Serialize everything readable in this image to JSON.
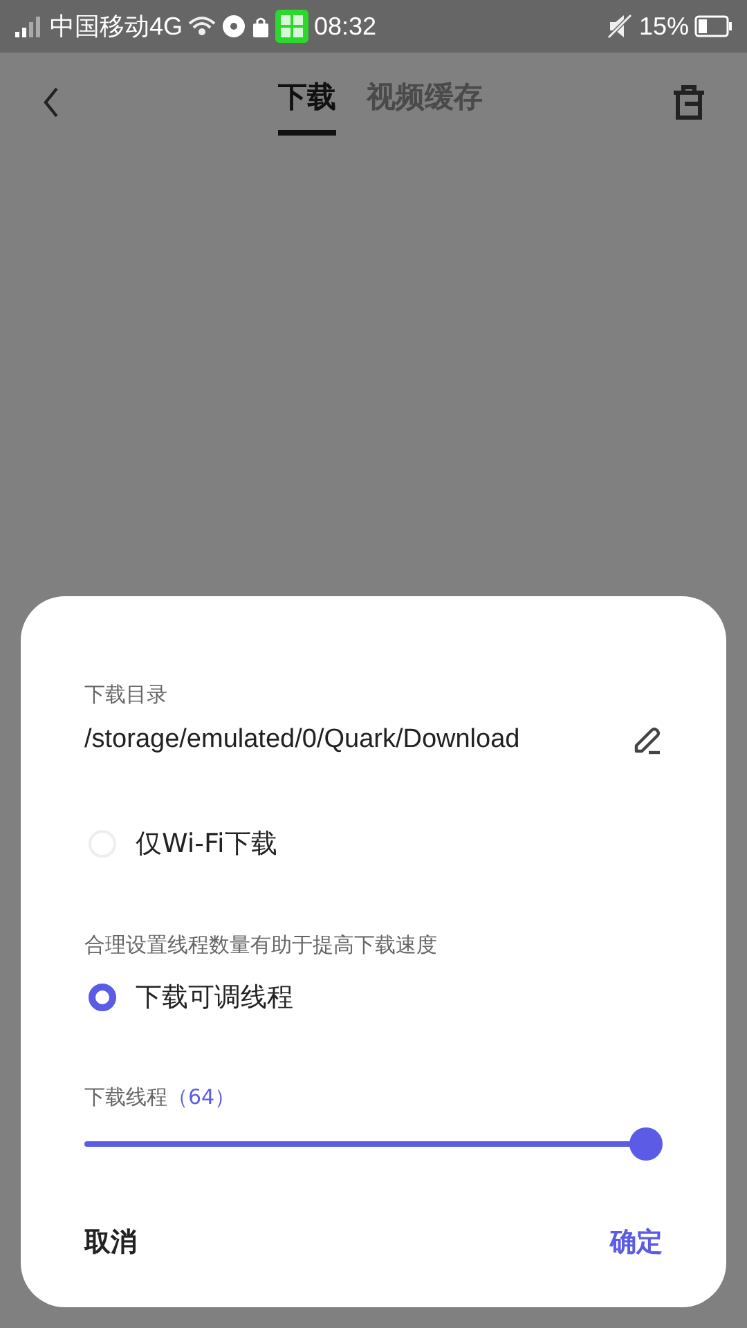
{
  "status_bar": {
    "carrier": "中国移动4G",
    "time": "08:32",
    "battery": "15%"
  },
  "tabs": [
    {
      "label": "下载",
      "selected": true
    },
    {
      "label": "视频缓存",
      "selected": false
    }
  ],
  "dialog": {
    "directory_label": "下载目录",
    "directory_path": "/storage/emulated/0/Quark/Download",
    "options": [
      {
        "label": "仅Wi-Fi下载",
        "selected": false
      },
      {
        "hint": "合理设置线程数量有助于提高下载速度",
        "label": "下载可调线程",
        "selected": true
      }
    ],
    "threads": {
      "label": "下载线程",
      "value": "（64）",
      "level": 1.0
    },
    "buttons": [
      {
        "label": "取消",
        "kind": "cancel"
      },
      {
        "label": "确定",
        "kind": "confirm"
      }
    ]
  }
}
